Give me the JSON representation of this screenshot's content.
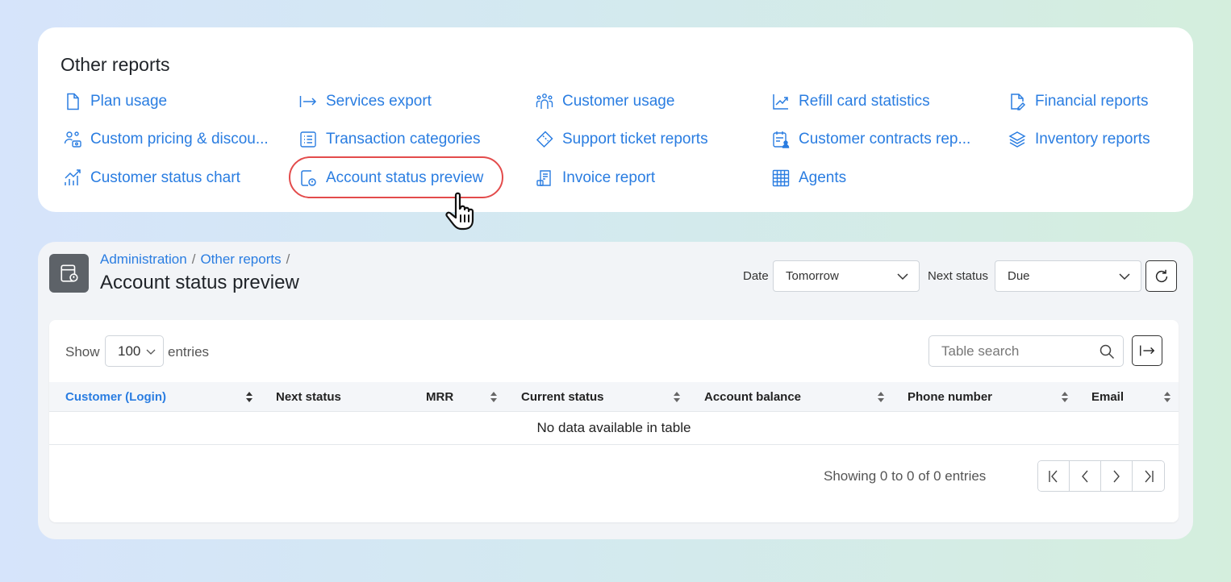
{
  "reports_card": {
    "title": "Other reports",
    "links": [
      {
        "label": "Plan usage",
        "icon": "file-icon"
      },
      {
        "label": "Services export",
        "icon": "arrow-right-bar-icon"
      },
      {
        "label": "Customer usage",
        "icon": "users-group-icon"
      },
      {
        "label": "Refill card statistics",
        "icon": "trend-chart-icon"
      },
      {
        "label": "Financial reports",
        "icon": "file-edit-icon"
      },
      {
        "label": "Custom pricing & discou...",
        "icon": "users-pricing-icon"
      },
      {
        "label": "Transaction categories",
        "icon": "list-icon"
      },
      {
        "label": "Support ticket reports",
        "icon": "ticket-icon"
      },
      {
        "label": "Customer contracts rep...",
        "icon": "calendar-user-icon"
      },
      {
        "label": "Inventory reports",
        "icon": "layers-icon"
      },
      {
        "label": "Customer status chart",
        "icon": "bar-chart-icon"
      },
      {
        "label": "Account status preview",
        "icon": "account-status-icon"
      },
      {
        "label": "Invoice report",
        "icon": "invoice-icon"
      },
      {
        "label": "Agents",
        "icon": "grid-table-icon"
      }
    ],
    "highlighted": "Account status preview",
    "highlight_color": "#e34b4b"
  },
  "header": {
    "breadcrumb": [
      "Administration",
      "Other reports"
    ],
    "title": "Account status preview",
    "date_label": "Date",
    "date_value": "Tomorrow",
    "next_status_label": "Next status",
    "next_status_value": "Due"
  },
  "table": {
    "show_label": "Show",
    "page_length": "100",
    "entries_label": "entries",
    "search_placeholder": "Table search",
    "columns": [
      {
        "label": "Customer (Login)",
        "active": true
      },
      {
        "label": "Next status"
      },
      {
        "label": "MRR"
      },
      {
        "label": "Current status"
      },
      {
        "label": "Account balance"
      },
      {
        "label": "Phone number"
      },
      {
        "label": "Email"
      }
    ],
    "empty_text": "No data available in table",
    "info_text": "Showing 0 to 0 of 0 entries"
  },
  "colors": {
    "link": "#2a7de1",
    "accent_ring": "#e34b4b",
    "page_icon_bg": "#5d6268"
  }
}
